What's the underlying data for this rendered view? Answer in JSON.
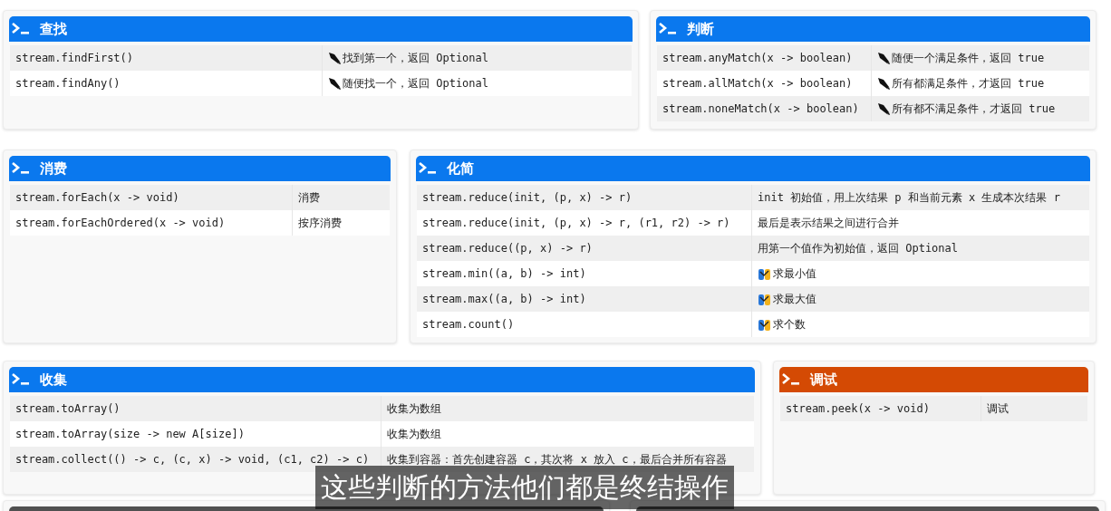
{
  "sections": [
    {
      "title": "查找",
      "color": "#0a78ee",
      "rows": [
        {
          "method": "stream.findFirst()",
          "description": "找到第一个，返回 Optional",
          "kind": "quill"
        },
        {
          "method": "stream.findAny()",
          "description": "随便找一个，返回 Optional",
          "kind": "quill"
        }
      ]
    },
    {
      "title": "判断",
      "color": "#0a78ee",
      "rows": [
        {
          "method": "stream.anyMatch(x -> boolean)",
          "description": "随便一个满足条件，返回 true",
          "kind": "quill"
        },
        {
          "method": "stream.allMatch(x -> boolean)",
          "description": "所有都满足条件，才返回 true",
          "kind": "quill"
        },
        {
          "method": "stream.noneMatch(x -> boolean)",
          "description": "所有都不满足条件，才返回 true",
          "kind": "quill"
        }
      ]
    },
    {
      "title": "消费",
      "color": "#0a78ee",
      "rows": [
        {
          "method": "stream.forEach(x -> void)",
          "description": "消费"
        },
        {
          "method": "stream.forEachOrdered(x -> void)",
          "description": "按序消费"
        }
      ]
    },
    {
      "title": "化简",
      "color": "#0a78ee",
      "rows": [
        {
          "method": "stream.reduce(init, (p, x) -> r)",
          "description": "init 初始值，用上次结果 p 和当前元素 x 生成本次结果 r"
        },
        {
          "method": "stream.reduce(init, (p, x) -> r, (r1, r2) -> r)",
          "description": "最后是表示结果之间进行合并"
        },
        {
          "method": "stream.reduce((p, x) -> r)",
          "description": "用第一个值作为初始值，返回 Optional"
        },
        {
          "method": "stream.min((a, b) -> int)",
          "description": "求最小值",
          "kind": "hands"
        },
        {
          "method": "stream.max((a, b) -> int)",
          "description": "求最大值",
          "kind": "hands"
        },
        {
          "method": "stream.count()",
          "description": "求个数",
          "kind": "hands"
        }
      ]
    },
    {
      "title": "收集",
      "color": "#0a78ee",
      "rows": [
        {
          "method": "stream.toArray()",
          "description": "收集为数组"
        },
        {
          "method": "stream.toArray(size -> new A[size])",
          "description": "收集为数组"
        },
        {
          "method": "stream.collect(() -> c, (c, x) -> void, (c1, c2) -> c)",
          "description": "收集到容器：首先创建容器 c，其次将 x 放入 c，最后合并所有容器"
        }
      ]
    },
    {
      "title": "调试",
      "color": "#d44a04",
      "rows": [
        {
          "method": "stream.peek(x -> void)",
          "description": "调试"
        }
      ]
    },
    {
      "color": "#505050"
    },
    {
      "color": "#505050"
    }
  ],
  "subtitle": "这些判断的方法他们都是终结操作"
}
